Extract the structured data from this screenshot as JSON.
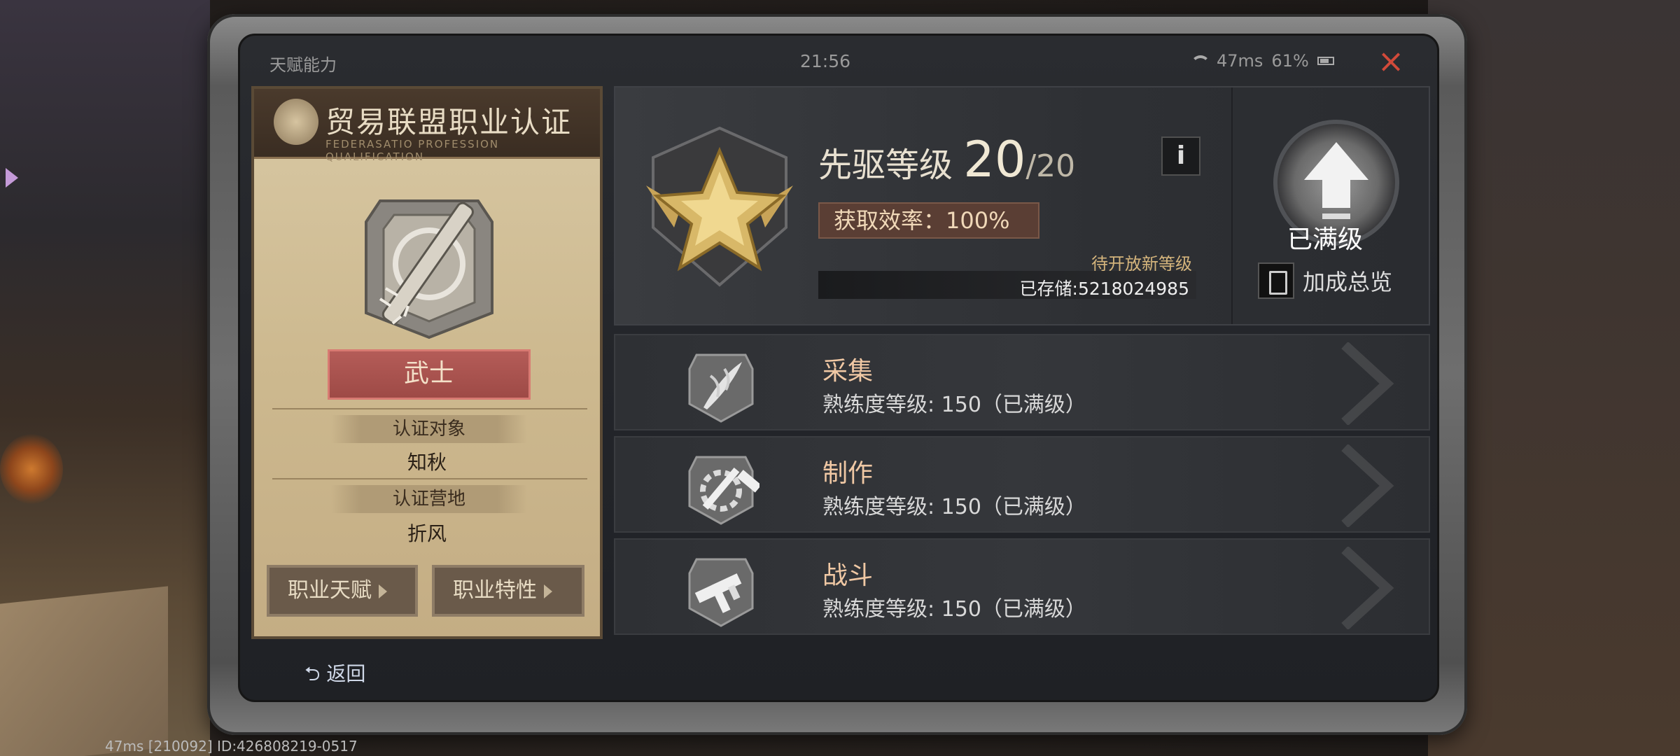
{
  "status": {
    "window_title": "天赋能力",
    "time": "21:56",
    "ping": "47ms",
    "battery": "61%"
  },
  "card": {
    "header_title": "贸易联盟职业认证",
    "header_subtitle": "FEDERASATIO PROFESSION QUALIFICATION",
    "job_name": "武士",
    "target_label": "认证对象",
    "target_value": "知秋",
    "camp_label": "认证营地",
    "camp_value": "折风",
    "btn_talent": "职业天赋",
    "btn_trait": "职业特性"
  },
  "pioneer": {
    "title": "先驱等级",
    "level": "20",
    "max_level": "/20",
    "efficiency": "获取效率：100%",
    "pending": "待开放新等级",
    "stored": "已存储:5218024985",
    "maxed_label": "已满级",
    "summary_label": "加成总览"
  },
  "skills": [
    {
      "name": "采集",
      "desc": "熟练度等级: 150（已满级）",
      "icon": "leaf-icon"
    },
    {
      "name": "制作",
      "desc": "熟练度等级: 150（已满级）",
      "icon": "hammer-gear-icon"
    },
    {
      "name": "战斗",
      "desc": "熟练度等级: 150（已满级）",
      "icon": "gun-icon"
    }
  ],
  "nav": {
    "back": "返回"
  },
  "footer": "47ms  [210092] ID:426808219-0517",
  "colors": {
    "accent_red": "#9e4a46",
    "close_red": "#d24a3a",
    "skill_name": "#f0c8a4",
    "gold": "#d4b47c"
  }
}
